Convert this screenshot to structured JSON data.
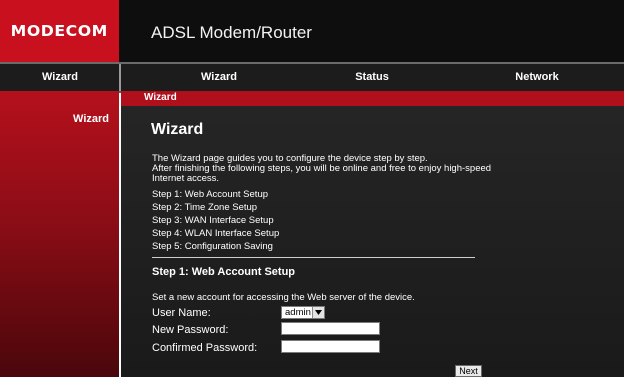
{
  "brand": {
    "logo_text": "MODECOM",
    "app_title": "ADSL Modem/Router",
    "accent_color": "#c8101e"
  },
  "navbar": {
    "section_label": "Wizard",
    "tabs": [
      {
        "label": "Wizard"
      },
      {
        "label": "Status"
      },
      {
        "label": "Network"
      }
    ]
  },
  "sidebar": {
    "items": [
      {
        "label": "Wizard"
      }
    ]
  },
  "breadcrumb": {
    "label": "Wizard"
  },
  "main": {
    "title": "Wizard",
    "intro_lines": [
      "The Wizard page guides you to configure the device step by step.",
      "After finishing the following steps, you will be online and free to enjoy high-speed",
      "Internet access."
    ],
    "steps": [
      "Step 1: Web Account Setup",
      "Step 2: Time Zone Setup",
      "Step 3: WAN Interface Setup",
      "Step 4: WLAN Interface Setup",
      "Step 5: Configuration Saving"
    ],
    "section_title": "Step 1: Web Account Setup",
    "section_desc": "Set a new account for accessing the Web server of the device.",
    "form": {
      "user_name_label": "User Name:",
      "user_name_value": "admin",
      "new_password_label": "New Password:",
      "new_password_value": "",
      "confirm_password_label": "Confirmed Password:",
      "confirm_password_value": ""
    },
    "next_label": "Next"
  }
}
